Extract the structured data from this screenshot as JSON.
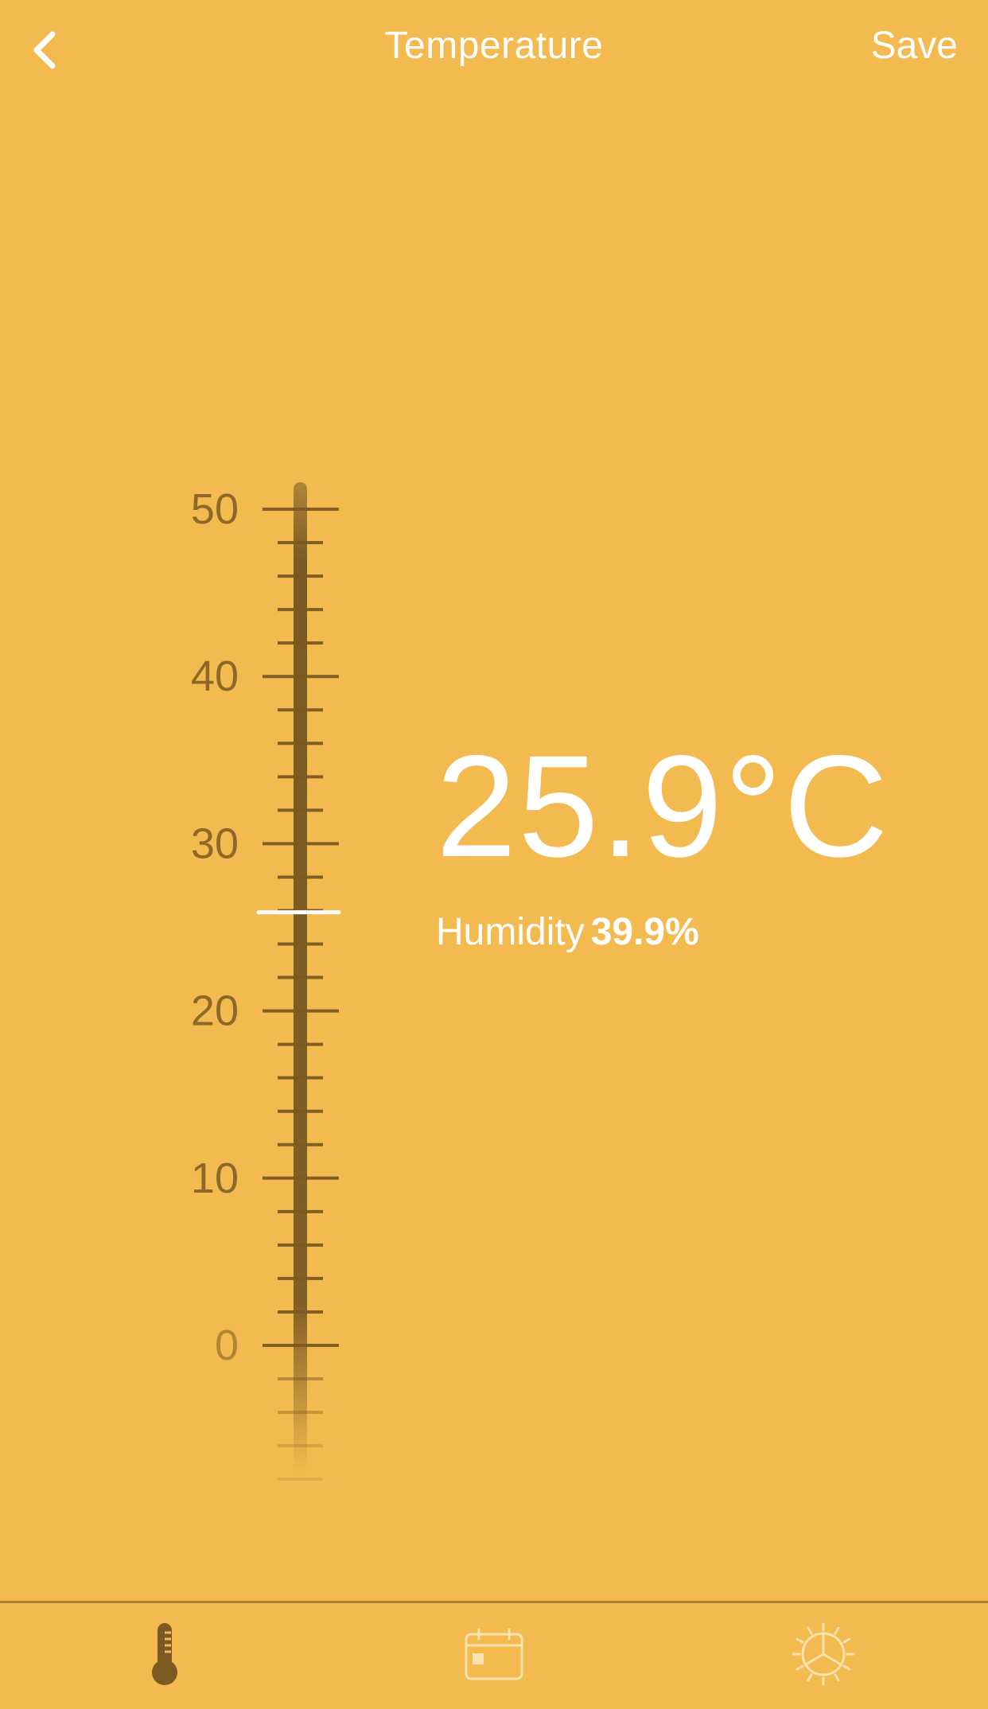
{
  "header": {
    "title": "Temperature",
    "save_label": "Save",
    "back_icon": "chevron-left-icon"
  },
  "thermometer": {
    "scale_labels": [
      "50",
      "40",
      "30",
      "20",
      "10",
      "0"
    ],
    "scale_max": 50,
    "scale_min": 0,
    "current_value": 25.9,
    "tick_step": 2
  },
  "reading": {
    "temperature": "25.9°C",
    "humidity_label": "Humidity",
    "humidity_value": "39.9%"
  },
  "bottom_nav": {
    "items": [
      {
        "icon": "thermometer-icon",
        "active": true
      },
      {
        "icon": "calendar-icon",
        "active": false
      },
      {
        "icon": "sun-settings-icon",
        "active": false
      }
    ]
  },
  "colors": {
    "background": "#f3ba4f",
    "scale": "#7a5a22",
    "accent": "#ffffff",
    "active_nav": "#7d5a22",
    "inactive_nav": "#fbe3b0"
  }
}
